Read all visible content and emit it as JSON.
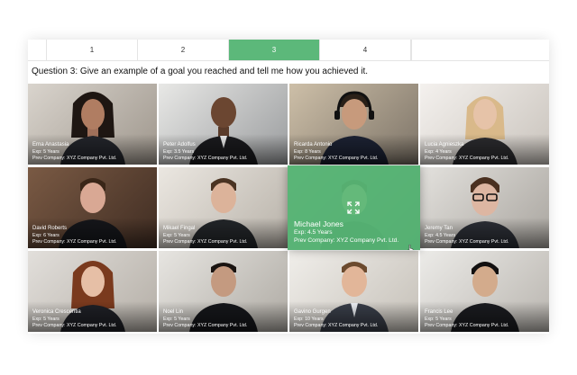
{
  "tabs": [
    {
      "label": "1",
      "active": false
    },
    {
      "label": "2",
      "active": false
    },
    {
      "label": "3",
      "active": true
    },
    {
      "label": "4",
      "active": false
    }
  ],
  "question": "Question 3: Give an example of a goal you reached and tell me how you achieved it.",
  "candidates": [
    {
      "name": "Erna Anastasia",
      "exp": "Exp: 5 Years",
      "company": "Prev Company: XYZ Company Pvt. Ltd."
    },
    {
      "name": "Peter Adolfus",
      "exp": "Exp: 3.5 Years",
      "company": "Prev Company: XYZ Company Pvt. Ltd."
    },
    {
      "name": "Ricarda Antonio",
      "exp": "Exp: 8 Years",
      "company": "Prev Company: XYZ Company Pvt. Ltd."
    },
    {
      "name": "Lucia Agnieszka",
      "exp": "Exp: 4 Years",
      "company": "Prev Company: XYZ Company Pvt. Ltd."
    },
    {
      "name": "David Roberts",
      "exp": "Exp: 6 Years",
      "company": "Prev Company: XYZ Company Pvt. Ltd."
    },
    {
      "name": "Mikael Fingal",
      "exp": "Exp: 5 Years",
      "company": "Prev Company: XYZ Company Pvt. Ltd."
    },
    {
      "name": "Michael Jones",
      "exp": "Exp: 4.5 Years",
      "company": "Prev Company: XYZ Company Pvt. Ltd.",
      "highlighted": true
    },
    {
      "name": "Jeremy Tan",
      "exp": "Exp: 4.5 Years",
      "company": "Prev Company: XYZ Company Pvt. Ltd."
    },
    {
      "name": "Veronica Crescentia",
      "exp": "Exp: 5 Years",
      "company": "Prev Company: XYZ Company Pvt. Ltd."
    },
    {
      "name": "Noel Lin",
      "exp": "Exp: 5 Years",
      "company": "Prev Company: XYZ Company Pvt. Ltd."
    },
    {
      "name": "Gavino Gurgen",
      "exp": "Exp: 10 Years",
      "company": "Prev Company: XYZ Company Pvt. Ltd."
    },
    {
      "name": "Francis Lee",
      "exp": "Exp: 5 Years",
      "company": "Prev Company: XYZ Company Pvt. Ltd."
    }
  ],
  "colors": {
    "accent": "#5cb87a",
    "overlay": "#5bbe7a"
  },
  "icons": {
    "expand": "expand-icon",
    "cursor": "pointer-cursor-icon"
  }
}
